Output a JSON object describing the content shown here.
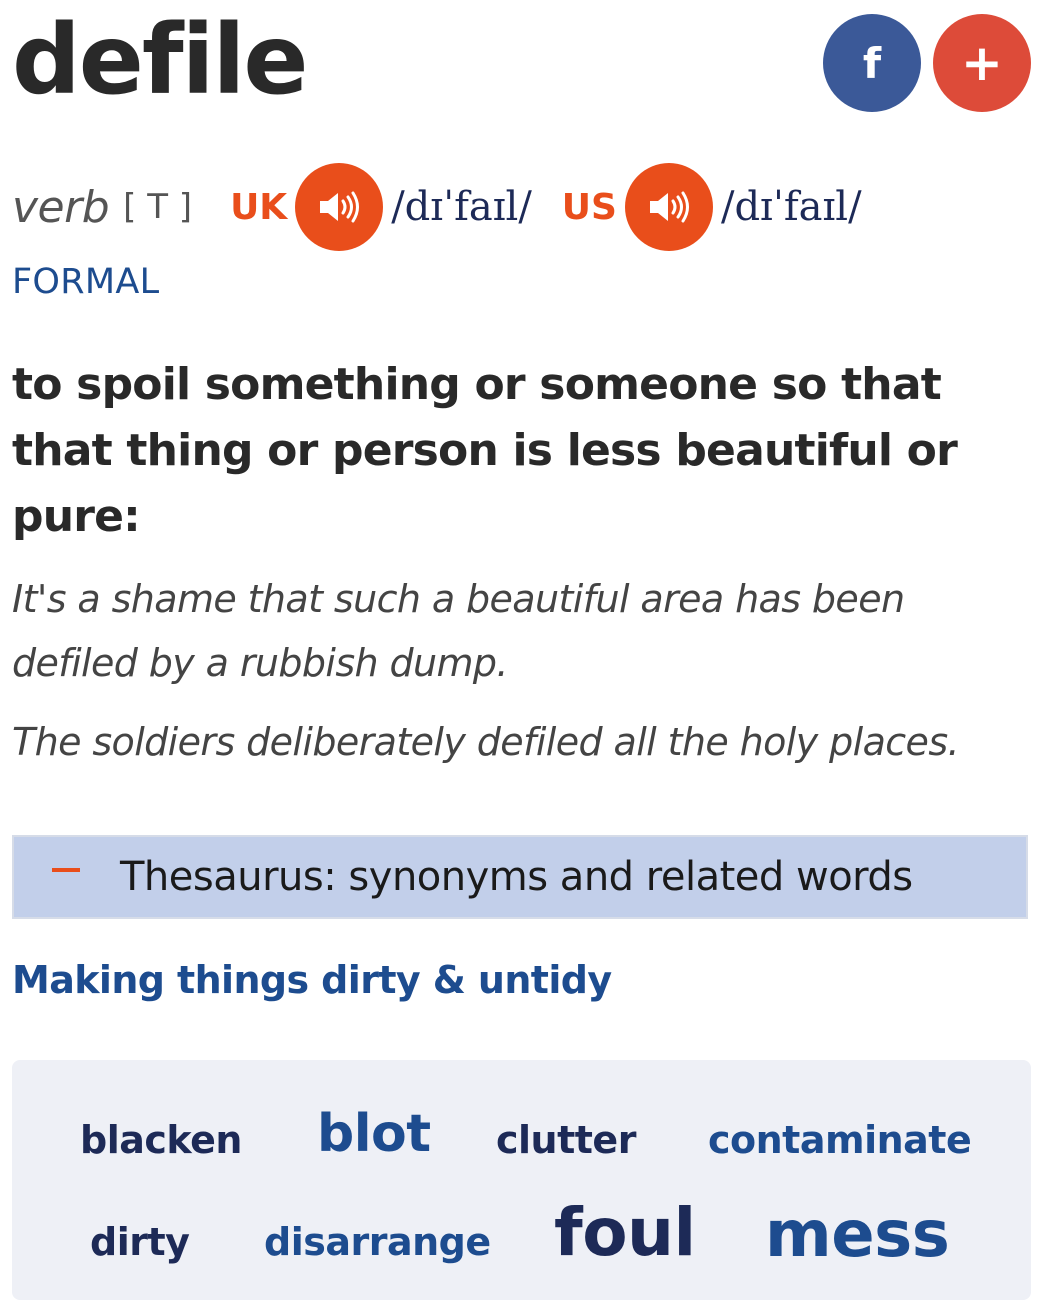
{
  "entry": {
    "headword": "defile",
    "part_of_speech": "verb",
    "grammar": "[ T ]",
    "pronunciations": [
      {
        "region": "UK",
        "ipa": "/dɪˈfaɪl/",
        "audio_icon": "speaker-icon"
      },
      {
        "region": "US",
        "ipa": "/dɪˈfaɪl/",
        "audio_icon": "speaker-icon"
      }
    ],
    "register_label": "FORMAL",
    "definition": "to spoil something or someone so that that thing or person is less beautiful or pure:",
    "examples": [
      "It's a shame that such a beautiful area has been defiled by a rubbish dump.",
      "The soldiers deliberately defiled all the holy places."
    ]
  },
  "share": {
    "facebook_label": "f",
    "more_label": "+",
    "facebook_color": "#3b5998",
    "more_color": "#dd4b39"
  },
  "thesaurus": {
    "toggle_label": "Thesaurus: synonyms and related words",
    "category": "Making things dirty & untidy",
    "words": [
      "blacken",
      "blot",
      "clutter",
      "contaminate",
      "dirty",
      "disarrange",
      "foul",
      "mess"
    ]
  },
  "colors": {
    "accent": "#e94e1b",
    "link": "#1d4c8f",
    "thesaurus_bar": "#c2cfea",
    "word_panel": "#eef0f6"
  }
}
